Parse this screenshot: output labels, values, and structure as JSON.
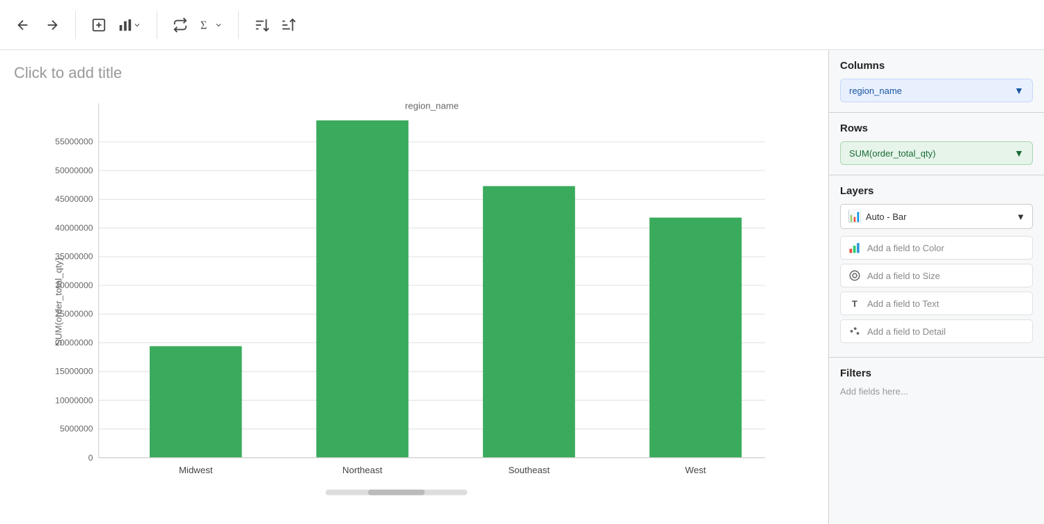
{
  "toolbar": {
    "back_label": "←",
    "forward_label": "→"
  },
  "chart": {
    "title": "Click to add title",
    "x_axis_label": "region_name",
    "y_axis_label": "SUM(order_total_qty)",
    "bars": [
      {
        "label": "Midwest",
        "value": 19500000,
        "color": "#3aab5c"
      },
      {
        "label": "Northeast",
        "value": 59000000,
        "color": "#3aab5c"
      },
      {
        "label": "Southeast",
        "value": 47500000,
        "color": "#3aab5c"
      },
      {
        "label": "West",
        "value": 42000000,
        "color": "#3aab5c"
      }
    ],
    "y_ticks": [
      0,
      5000000,
      10000000,
      15000000,
      20000000,
      25000000,
      30000000,
      35000000,
      40000000,
      45000000,
      50000000,
      55000000
    ],
    "y_max": 62000000
  },
  "panel": {
    "columns_title": "Columns",
    "columns_field": "region_name",
    "rows_title": "Rows",
    "rows_field": "SUM(order_total_qty)",
    "layers_title": "Layers",
    "layers_type": "Auto - Bar",
    "color_label": "Add a field to Color",
    "size_label": "Add a field to Size",
    "text_label": "Add a field to Text",
    "detail_label": "Add a field to Detail",
    "filters_title": "Filters",
    "filters_placeholder": "Add fields here..."
  }
}
